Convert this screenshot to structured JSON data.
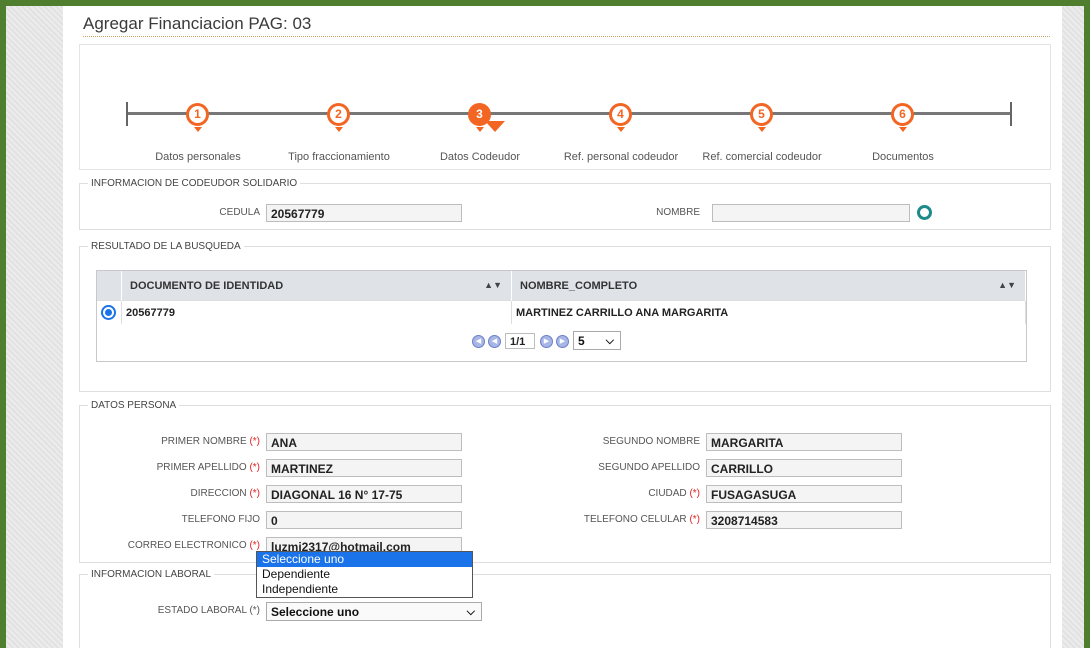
{
  "page": {
    "title": "Agregar Financiacion PAG: 03"
  },
  "steps": [
    {
      "num": "1",
      "label": "Datos personales"
    },
    {
      "num": "2",
      "label": "Tipo fraccionamiento"
    },
    {
      "num": "3",
      "label": "Datos Codeudor"
    },
    {
      "num": "4",
      "label": "Ref. personal codeudor"
    },
    {
      "num": "5",
      "label": "Ref. comercial codeudor"
    },
    {
      "num": "6",
      "label": "Documentos"
    }
  ],
  "active_step": "3",
  "codeudor": {
    "legend": "INFORMACION DE CODEUDOR SOLIDARIO",
    "cedula_label": "CEDULA",
    "cedula_value": "20567779",
    "nombre_label": "NOMBRE",
    "nombre_value": "",
    "search_icon": "search-icon"
  },
  "resultado": {
    "legend": "RESULTADO DE LA BUSQUEDA",
    "columns": [
      "DOCUMENTO DE IDENTIDAD",
      "NOMBRE_COMPLETO"
    ],
    "rows": [
      [
        "20567779",
        "MARTINEZ CARRILLO ANA MARGARITA"
      ]
    ],
    "page_indicator": "1/1",
    "page_size": "5"
  },
  "persona": {
    "legend": "DATOS PERSONA",
    "required_mark": "(*)",
    "primer_nombre_label": "PRIMER NOMBRE",
    "primer_nombre": "ANA",
    "segundo_nombre_label": "SEGUNDO NOMBRE",
    "segundo_nombre": "MARGARITA",
    "primer_apellido_label": "PRIMER APELLIDO",
    "primer_apellido": "MARTINEZ",
    "segundo_apellido_label": "SEGUNDO APELLIDO",
    "segundo_apellido": "CARRILLO",
    "direccion_label": "DIRECCION",
    "direccion": "DIAGONAL 16 N° 17-75",
    "ciudad_label": "CIUDAD",
    "ciudad": "FUSAGASUGA",
    "telefono_fijo_label": "TELEFONO FIJO",
    "telefono_fijo": "0",
    "telefono_celular_label": "TELEFONO CELULAR",
    "telefono_celular": "3208714583",
    "correo_label": "CORREO ELECTRONICO",
    "correo": "luzmi2317@hotmail.com"
  },
  "laboral": {
    "legend": "INFORMACION LABORAL",
    "estado_label": "ESTADO LABORAL (*)",
    "estado_value": "Seleccione uno",
    "options": [
      "Seleccione uno",
      "Dependiente",
      "Independiente"
    ]
  },
  "colors": {
    "accent": "#f26522",
    "border_frame": "#4f7f2e",
    "selected_option": "#1a73e8"
  }
}
